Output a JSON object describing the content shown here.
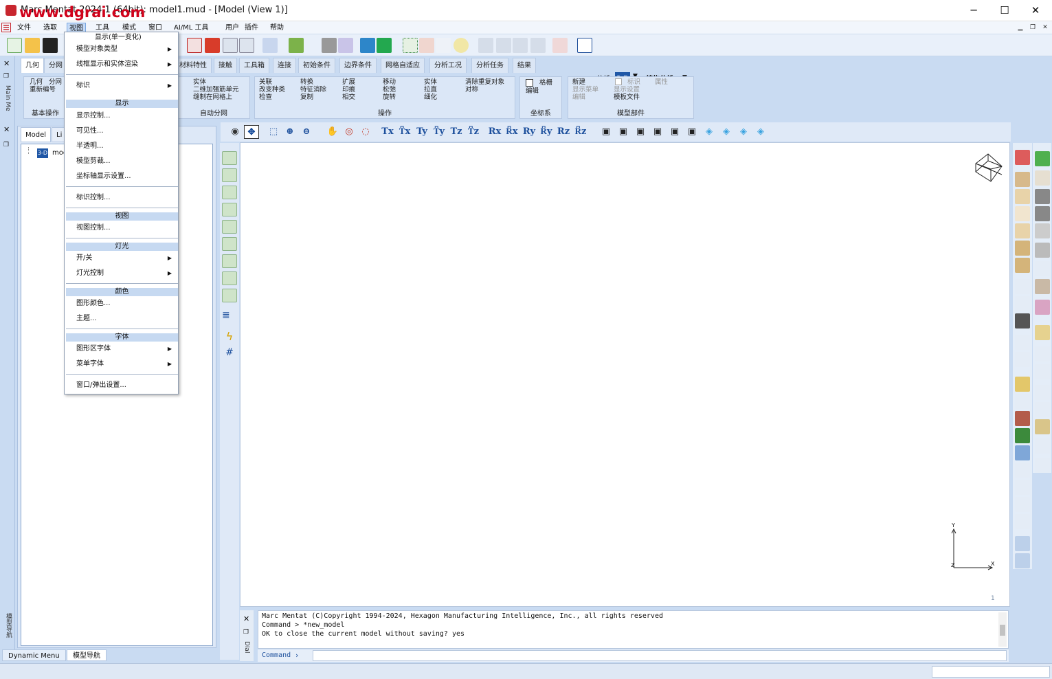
{
  "window": {
    "title": "Marc Mentat 2024.1 (64bit): model1.mud - [Model (View 1)]",
    "watermark": "www.dgrai.com",
    "minimize": "─",
    "maximize": "☐",
    "close": "✕"
  },
  "menubar": {
    "items": [
      "文件",
      "选取",
      "视图",
      "工具",
      "模式",
      "窗口",
      "AI/ML 工具",
      "用户",
      "插件",
      "帮助"
    ],
    "active_index": 2
  },
  "toolbar": {
    "analysis_label": "分析",
    "mode_label": "3-D",
    "structural_label": "结构分析"
  },
  "tabs": [
    "几何",
    "分网",
    "材料特性",
    "接触",
    "工具箱",
    "连接",
    "初始条件",
    "边界条件",
    "网格自适应",
    "分析工况",
    "分析任务",
    "结果"
  ],
  "ribbon": {
    "group_basic": {
      "label": "基本操作",
      "items": [
        "几何",
        "分网",
        "重新编号"
      ]
    },
    "group_auto": {
      "label": "自动分网",
      "items": [
        "实体",
        "二维加强筋单元",
        "缝制在网格上"
      ]
    },
    "group_ops": {
      "label": "操作",
      "col1": [
        "关联",
        "改变种类",
        "检查"
      ],
      "col2": [
        "转换",
        "特征消除",
        "复制"
      ],
      "col3": [
        "扩展",
        "印痕",
        "相交"
      ],
      "col4": [
        "移动",
        "松弛",
        "旋转"
      ],
      "col5": [
        "实体",
        "拉直",
        "细化"
      ],
      "col6": [
        "清除重复对象",
        "对称"
      ]
    },
    "group_coord": {
      "label": "坐标系",
      "items": [
        "格栅",
        "编辑"
      ]
    },
    "group_parts": {
      "label": "模型部件",
      "items": [
        "新建",
        "显示菜单",
        "编辑",
        "标识",
        "显示设置",
        "模板文件",
        "属性"
      ]
    }
  },
  "left_panel": {
    "side_label_top": "Main Me",
    "side_label_bottom": "模型导航",
    "tree_tabs": [
      "Model",
      "Li"
    ],
    "tree_root_badge": "3-D",
    "tree_root_label": "mod"
  },
  "view_toolbar": {
    "buttons": [
      "Tx",
      "T͆x",
      "Ty",
      "T͆y",
      "Tz",
      "T͆z",
      "Rx",
      "R͆x",
      "Ry",
      "R͆y",
      "Rz",
      "R͆z"
    ]
  },
  "viewport": {
    "axis_y": "Y",
    "axis_x": "X",
    "axis_z": "Z",
    "view_number": "1"
  },
  "dialog": {
    "side_label": "Dial",
    "lines": [
      "Marc Mentat (C)Copyright 1994-2024, Hexagon Manufacturing Intelligence, Inc., all rights reserved",
      "Command > *new_model",
      "OK to close the current model without saving? yes"
    ],
    "command_label": "Command",
    "command_arrow": "›"
  },
  "bottom_tabs": [
    "Dynamic Menu",
    "模型导航"
  ],
  "dropdown": {
    "top_item": "显示(单一变化)",
    "items": [
      {
        "label": "模型对象类型",
        "submenu": true
      },
      {
        "label": "线框显示和实体渲染",
        "submenu": true
      },
      {
        "label": "标识",
        "submenu": true
      }
    ],
    "section_display": "显示",
    "display_items": [
      "显示控制...",
      "可见性...",
      "半透明...",
      "模型剪裁...",
      "坐标轴显示设置..."
    ],
    "label_item": "标识控制...",
    "section_view": "视图",
    "view_items": [
      "视图控制..."
    ],
    "section_light": "灯光",
    "light_items": [
      {
        "label": "开/关",
        "submenu": true
      },
      {
        "label": "灯光控制",
        "submenu": true
      }
    ],
    "section_color": "颜色",
    "color_items": [
      "图形颜色...",
      "主题..."
    ],
    "section_font": "字体",
    "font_items": [
      {
        "label": "图形区字体",
        "submenu": true
      },
      {
        "label": "菜单字体",
        "submenu": true
      }
    ],
    "window_item": "窗口/弹出设置...",
    "submenu_arrow": "▶"
  },
  "colors": {
    "accent": "#c6d9f1",
    "frame": "#c9dbf2",
    "watermark": "#d0021b"
  }
}
